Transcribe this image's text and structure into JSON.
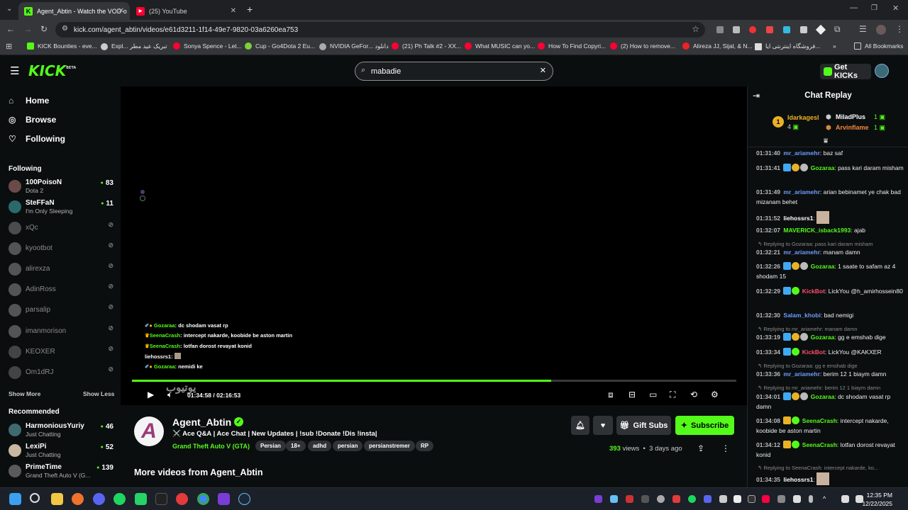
{
  "browser": {
    "tabs": [
      {
        "title": "Agent_Abtin - Watch the VOD o",
        "active": true,
        "icon": "kick-icon"
      },
      {
        "title": "(25) YouTube",
        "active": false,
        "icon": "youtube-icon"
      }
    ],
    "new_tab": "+",
    "url": "kick.com/agent_abtin/videos/e61d3211-1f14-49e7-9820-03a6260ea753",
    "bookmarks": [
      "KICK Bounties - eve...",
      "Expl... تبریک عید مطر",
      "Sonya Spence - Let...",
      "Cup - Go4Dota 2 Eu...",
      "NVIDIA GeFor... دانلود",
      "(21) Ph Talk #2 - XX...",
      "What MUSIC can yo...",
      "How To Find Copyri...",
      "(2) How to remove...",
      "Alireza JJ, Sijal, & N...",
      "فروشگاه اینترنتی ایا...",
      "All Bookmarks"
    ]
  },
  "header": {
    "logo": "KICK",
    "logo_beta": "BETA",
    "search_value": "mabadie",
    "get_kicks": "Get KICKs"
  },
  "sidebar": {
    "nav": [
      {
        "label": "Home",
        "icon": "home-icon"
      },
      {
        "label": "Browse",
        "icon": "compass-icon"
      },
      {
        "label": "Following",
        "icon": "heart-icon"
      }
    ],
    "following_header": "Following",
    "following": [
      {
        "name": "100PoisoN",
        "game": "Dota 2",
        "viewers": "83",
        "live": true
      },
      {
        "name": "SteFFaN",
        "game": "I'm Only Sleeping",
        "viewers": "11",
        "live": true
      },
      {
        "name": "xQc",
        "live": false
      },
      {
        "name": "kyootbot",
        "live": false
      },
      {
        "name": "alirexza",
        "live": false
      },
      {
        "name": "AdinRoss",
        "live": false
      },
      {
        "name": "parsalip",
        "live": false
      },
      {
        "name": "imanmorison",
        "live": false
      },
      {
        "name": "KEOXER",
        "live": false
      },
      {
        "name": "Om1dRJ",
        "live": false
      }
    ],
    "show_more": "Show More",
    "show_less": "Show Less",
    "recommended_header": "Recommended",
    "recommended": [
      {
        "name": "HarmoniousYuriy",
        "game": "Just Chatting",
        "viewers": "46"
      },
      {
        "name": "LexiPi",
        "game": "Just Chatting",
        "viewers": "52"
      },
      {
        "name": "PrimeTime",
        "game": "Grand Theft Auto V (G...",
        "viewers": "139"
      }
    ]
  },
  "player": {
    "overlay_chat": [
      {
        "user": "Gozaraa",
        "text": "dc shodam vasat rp"
      },
      {
        "user": "SeenaCrash",
        "text": "intercept nakarde, koobide be aston martin"
      },
      {
        "user": "SeenaCrash",
        "text": "lotfan dorost revayat konid"
      },
      {
        "user": "liehossrs1",
        "text": ""
      },
      {
        "user": "Gozaraa",
        "text": "nemidi ke"
      }
    ],
    "current_time": "01:34:58",
    "duration": "02:16:53",
    "time_separator": "/",
    "progress": 0.694,
    "watermark": "یوتیوب"
  },
  "video": {
    "channel": "Agent_Abtin",
    "title": "⚔️ Ace Q&A | Ace Chat | New Updates | !sub !Donate !Dis !insta|",
    "category": "Grand Theft Auto V (GTA)",
    "tags": [
      "Persian",
      "18+",
      "adhd",
      "persian",
      "persianstremer",
      "RP"
    ],
    "gift_subs": "Gift Subs",
    "subscribe": "Subscribe",
    "views_count": "393",
    "views_label": "views",
    "age": "3 days ago",
    "more_videos": "More videos from Agent_Abtin"
  },
  "chat": {
    "title": "Chat Replay",
    "leaderboard": {
      "first": {
        "name": "Idarkagesl",
        "count": "4"
      },
      "others": [
        {
          "name": "MiladPlus",
          "count": "1"
        },
        {
          "name": "Arvinflame",
          "count": "1"
        }
      ]
    },
    "messages": [
      {
        "time": "01:31:40",
        "user": "mr_ariamehr",
        "color": "#6f9cff",
        "text": "baz saf"
      },
      {
        "time": "01:31:41",
        "user": "Gozaraa",
        "color": "#53fc18",
        "text": "pass kari daram misham"
      },
      {
        "time": "01:31:49",
        "user": "mr_ariamehr",
        "color": "#6f9cff",
        "text": "arian bebinamet ye chak bad mizanam behet"
      },
      {
        "time": "01:31:52",
        "user": "liehossrs1",
        "color": "#ffffff",
        "text": ""
      },
      {
        "time": "01:32:07",
        "user": "MAVERICK_isback1993",
        "color": "#53fc18",
        "text": "ajab"
      },
      {
        "reply": "Replying to Gozaraa: pass kari daram misham"
      },
      {
        "time": "01:32:21",
        "user": "mr_ariamehr",
        "color": "#6f9cff",
        "text": "manam damn"
      },
      {
        "time": "01:32:26",
        "user": "Gozaraa",
        "color": "#53fc18",
        "text": "1 saate to safam az 4 shodam 15"
      },
      {
        "time": "01:32:29",
        "user": "KickBot",
        "color": "#ff4d6d",
        "text": "LickYou @h_amirhossein80"
      },
      {
        "time": "01:32:30",
        "user": "Salam_khobi",
        "color": "#6f9cff",
        "text": "bad nemigi"
      },
      {
        "reply": "Replying to mr_ariamehr: manam damn"
      },
      {
        "time": "01:33:19",
        "user": "Gozaraa",
        "color": "#53fc18",
        "text": "gg e emshab dige"
      },
      {
        "time": "01:33:34",
        "user": "KickBot",
        "color": "#ff4d6d",
        "text": "LickYou @KAKXER"
      },
      {
        "reply": "Replying to Gozaraa: gg e emshab dige"
      },
      {
        "time": "01:33:36",
        "user": "mr_ariamehr",
        "color": "#6f9cff",
        "text": "berim 12 1 biaym damn"
      },
      {
        "reply": "Replying to mr_ariamehr: berim 12 1 biaym damn"
      },
      {
        "time": "01:34:01",
        "user": "Gozaraa",
        "color": "#53fc18",
        "text": "dc shodam vasat rp damn"
      },
      {
        "time": "01:34:08",
        "user": "SeenaCrash",
        "color": "#53fc18",
        "text": "intercept nakarde, koobide be aston martin"
      },
      {
        "time": "01:34:12",
        "user": "SeenaCrash",
        "color": "#53fc18",
        "text": "lotfan dorost revayat konid"
      },
      {
        "reply": "Replying to SeenaCrash: intercept nakarde, ko..."
      },
      {
        "time": "01:34:35",
        "user": "liehossrs1",
        "color": "#ffffff",
        "text": ""
      }
    ]
  },
  "taskbar": {
    "time": "12:35 PM",
    "date": "12/22/2025"
  },
  "colors": {
    "accent": "#53fc18",
    "background": "#0b0e0f",
    "panel": "#2f3336"
  }
}
